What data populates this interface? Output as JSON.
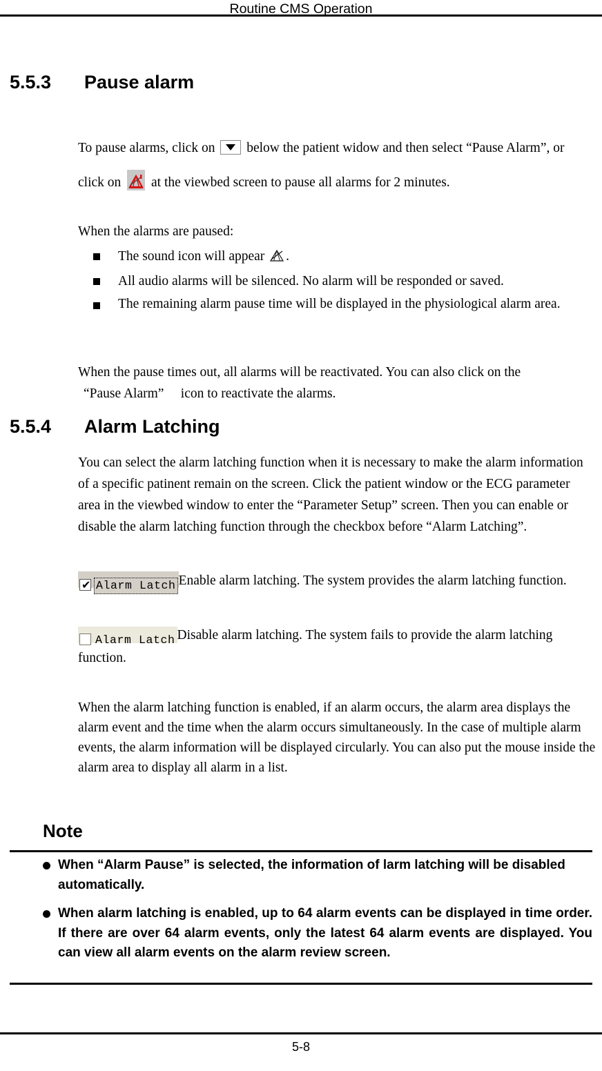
{
  "header": {
    "title": "Routine CMS Operation"
  },
  "sections": {
    "pause_alarm": {
      "number": "5.5.3",
      "title": "Pause alarm",
      "intro_part1": "To pause alarms, click on",
      "intro_part2": "below the patient widow and then select “Pause Alarm”, or click on",
      "intro_part3": "at the viewbed screen to pause all alarms for 2 minutes.",
      "paused_lead": "When the alarms are paused:",
      "bullets": [
        {
          "part1": "The sound icon will appear",
          "part2": "."
        },
        {
          "text": "All audio alarms will be silenced. No alarm will be responded or saved."
        },
        {
          "text": "The remaining alarm pause time will be displayed in the physiological alarm area."
        }
      ],
      "timeout_line1": "When the pause times out, all alarms will be reactivated. You can also click on the",
      "timeout_line2": "“Pause Alarm”　 icon to reactivate the alarms."
    },
    "alarm_latching": {
      "number": "5.5.4",
      "title": "Alarm Latching",
      "paragraph1": "You can select the alarm latching function when it is necessary to make the alarm information of a specific patinent remain on the screen. Click the patient window or the ECG parameter area in the viewbed window to enter the “Parameter Setup” screen. Then you can enable or disable the alarm latching function through the checkbox before “Alarm Latching”.",
      "checkbox_enabled": {
        "label": "Alarm Latch",
        "state": "checked",
        "tick": "✔",
        "description": "Enable alarm latching. The system provides the alarm latching function."
      },
      "checkbox_disabled": {
        "label": "Alarm Latch",
        "state": "unchecked",
        "description": "Disable alarm latching. The system fails to provide the alarm latching function."
      },
      "paragraph2": "When the alarm latching function is enabled, if an alarm occurs, the alarm area displays the alarm event and the time when the alarm occurs simultaneously. In the case of multiple alarm events, the alarm information will be displayed circularly. You can also put the mouse inside the alarm area to display all alarm in a list."
    }
  },
  "note": {
    "title": "Note",
    "items": [
      "When “Alarm Pause” is selected, the information of larm latching will be disabled automatically.",
      "When alarm latching is enabled, up to 64 alarm events can be displayed in time order. If there are over 64 alarm events, only the latest 64 alarm events are displayed. You can view all alarm events on the alarm review screen."
    ]
  },
  "footer": {
    "page_number": "5-8"
  },
  "icons": {
    "dropdown": "chevron-down-button-icon",
    "pause_alarm": "alarm-pause-icon",
    "sound_muted": "sound-muted-icon"
  },
  "colors": {
    "alarm_red": "#d31515",
    "widget_gray": "#d4d0c8",
    "widget_cream": "#ece9dd",
    "text": "#000000"
  }
}
